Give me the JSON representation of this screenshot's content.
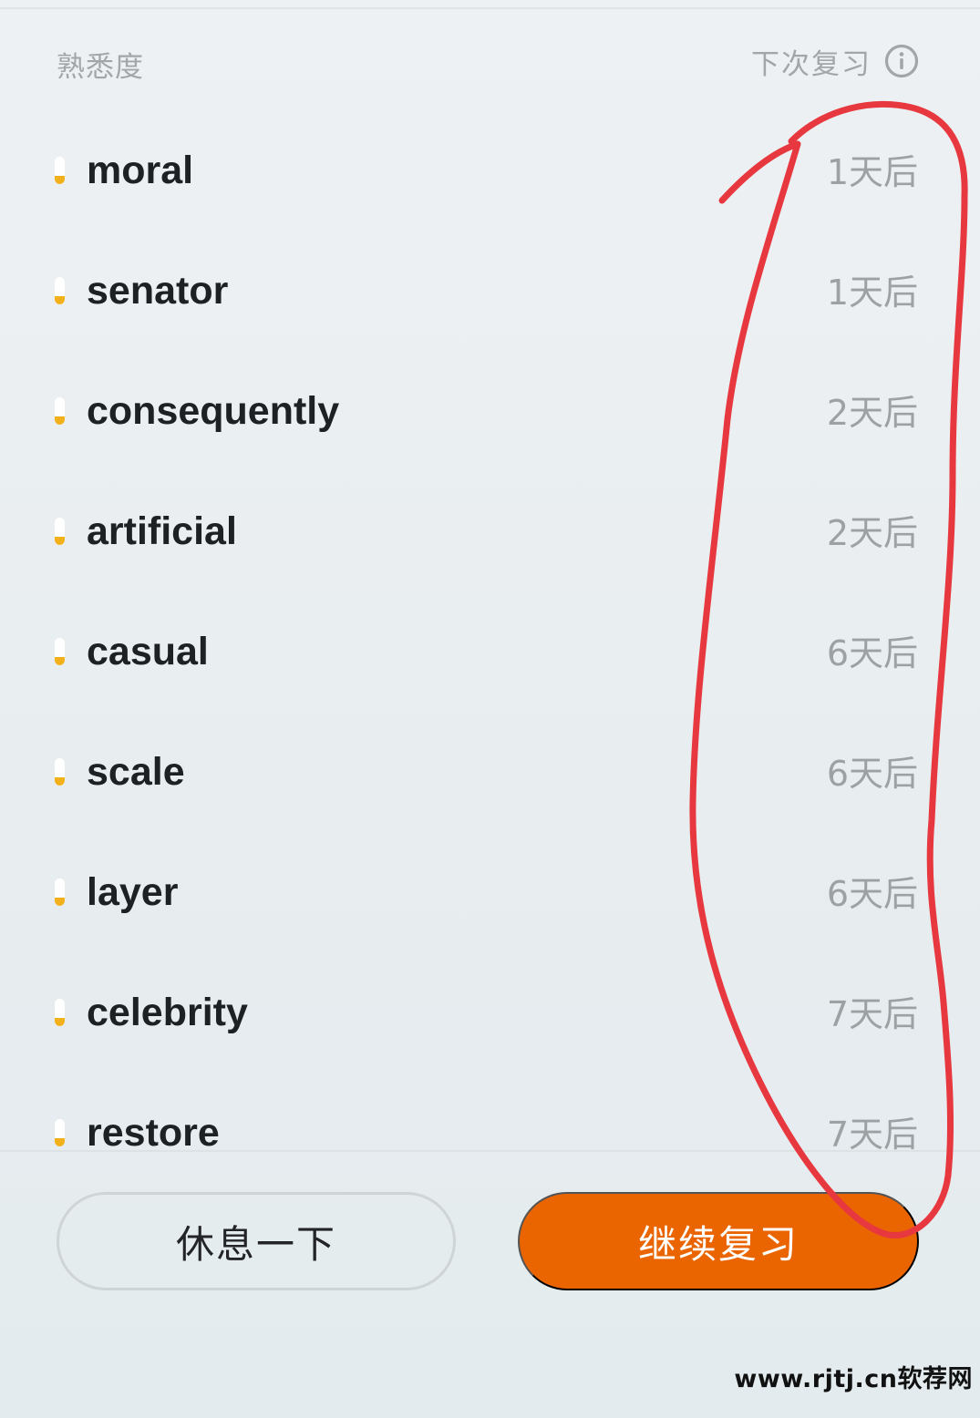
{
  "header": {
    "familiarity_label": "熟悉度",
    "next_review_label": "下次复习",
    "info_icon": "info-circle-icon"
  },
  "words": [
    {
      "word": "moral",
      "next_review": "1天后",
      "familiarity": 0.3
    },
    {
      "word": "senator",
      "next_review": "1天后",
      "familiarity": 0.3
    },
    {
      "word": "consequently",
      "next_review": "2天后",
      "familiarity": 0.3
    },
    {
      "word": "artificial",
      "next_review": "2天后",
      "familiarity": 0.3
    },
    {
      "word": "casual",
      "next_review": "6天后",
      "familiarity": 0.3
    },
    {
      "word": "scale",
      "next_review": "6天后",
      "familiarity": 0.3
    },
    {
      "word": "layer",
      "next_review": "6天后",
      "familiarity": 0.3
    },
    {
      "word": "celebrity",
      "next_review": "7天后",
      "familiarity": 0.3
    },
    {
      "word": "restore",
      "next_review": "7天后",
      "familiarity": 0.3
    }
  ],
  "buttons": {
    "rest_label": "休息一下",
    "continue_label": "继续复习"
  },
  "colors": {
    "accent": "#ea6500",
    "familiarity_fill": "#f2b01a",
    "annotation": "#e8383f"
  },
  "watermark": "www.rjtj.cn软荐网"
}
